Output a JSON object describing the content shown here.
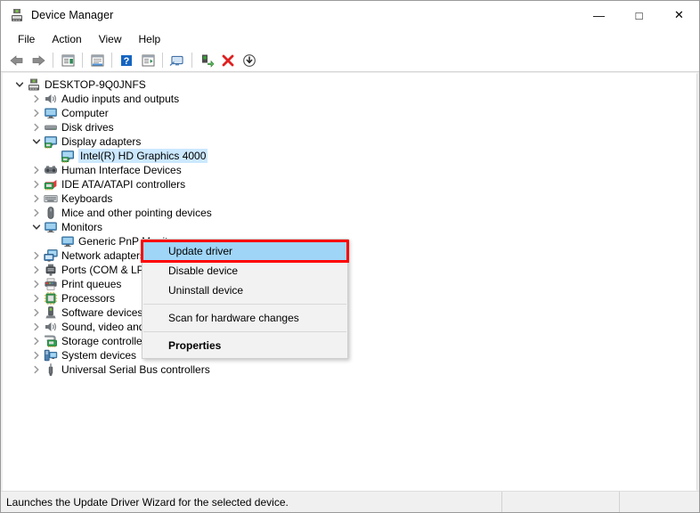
{
  "window": {
    "title": "Device Manager",
    "icon": "device-manager-icon",
    "controls": {
      "minimize": "—",
      "maximize": "□",
      "close": "✕"
    }
  },
  "menubar": {
    "items": [
      {
        "label": "File"
      },
      {
        "label": "Action"
      },
      {
        "label": "View"
      },
      {
        "label": "Help"
      }
    ]
  },
  "toolbar": {
    "buttons": [
      {
        "name": "back-icon"
      },
      {
        "name": "forward-icon"
      },
      {
        "name": "properties-icon"
      },
      {
        "name": "help-icon"
      },
      {
        "name": "update-driver-icon"
      },
      {
        "name": "scan-hardware-icon"
      },
      {
        "name": "enable-device-icon"
      },
      {
        "name": "uninstall-device-icon"
      },
      {
        "name": "disable-device-icon"
      }
    ]
  },
  "tree": {
    "root": {
      "label": "DESKTOP-9Q0JNFS",
      "icon": "computer-root-icon",
      "expanded": true,
      "indent": 0
    },
    "items": [
      {
        "label": "Audio inputs and outputs",
        "icon": "speaker-icon",
        "state": "collapsed",
        "indent": 1
      },
      {
        "label": "Computer",
        "icon": "monitor-icon",
        "state": "collapsed",
        "indent": 1
      },
      {
        "label": "Disk drives",
        "icon": "disk-icon",
        "state": "collapsed",
        "indent": 1
      },
      {
        "label": "Display adapters",
        "icon": "display-adapter-icon",
        "state": "expanded",
        "indent": 1
      },
      {
        "label": "Intel(R) HD Graphics 4000",
        "icon": "display-adapter-icon",
        "state": "leaf",
        "indent": 2,
        "selected": true
      },
      {
        "label": "Human Interface Devices",
        "icon": "hid-icon",
        "state": "collapsed",
        "indent": 1
      },
      {
        "label": "IDE ATA/ATAPI controllers",
        "icon": "ide-controller-icon",
        "state": "collapsed",
        "indent": 1
      },
      {
        "label": "Keyboards",
        "icon": "keyboard-icon",
        "state": "collapsed",
        "indent": 1
      },
      {
        "label": "Mice and other pointing devices",
        "icon": "mouse-icon",
        "state": "collapsed",
        "indent": 1
      },
      {
        "label": "Monitors",
        "icon": "monitor-icon",
        "state": "expanded",
        "indent": 1
      },
      {
        "label": "Generic PnP Monitor",
        "icon": "monitor-icon",
        "state": "leaf",
        "indent": 2
      },
      {
        "label": "Network adapters",
        "icon": "network-adapter-icon",
        "state": "collapsed",
        "indent": 1
      },
      {
        "label": "Ports (COM & LPT)",
        "icon": "port-icon",
        "state": "collapsed",
        "indent": 1
      },
      {
        "label": "Print queues",
        "icon": "printer-icon",
        "state": "collapsed",
        "indent": 1
      },
      {
        "label": "Processors",
        "icon": "processor-icon",
        "state": "collapsed",
        "indent": 1
      },
      {
        "label": "Software devices",
        "icon": "software-device-icon",
        "state": "collapsed",
        "indent": 1
      },
      {
        "label": "Sound, video and game controllers",
        "icon": "speaker-icon",
        "state": "collapsed",
        "indent": 1
      },
      {
        "label": "Storage controllers",
        "icon": "storage-controller-icon",
        "state": "collapsed",
        "indent": 1
      },
      {
        "label": "System devices",
        "icon": "system-device-icon",
        "state": "collapsed",
        "indent": 1
      },
      {
        "label": "Universal Serial Bus controllers",
        "icon": "usb-icon",
        "state": "collapsed",
        "indent": 1
      }
    ]
  },
  "context_menu": {
    "items": [
      {
        "label": "Update driver",
        "highlighted": true
      },
      {
        "label": "Disable device"
      },
      {
        "label": "Uninstall device"
      },
      {
        "label": "Scan for hardware changes",
        "separator_before": true
      },
      {
        "label": "Properties",
        "bold": true,
        "separator_before": true
      }
    ]
  },
  "statusbar": {
    "message": "Launches the Update Driver Wizard for the selected device.",
    "panel2": "",
    "panel3": ""
  },
  "colors": {
    "selection": "#cce8ff",
    "menu_highlight": "#9fd5f7",
    "highlight_outline": "#ff0000",
    "window_bg": "#f0f0f0",
    "pane_bg": "#ffffff"
  }
}
